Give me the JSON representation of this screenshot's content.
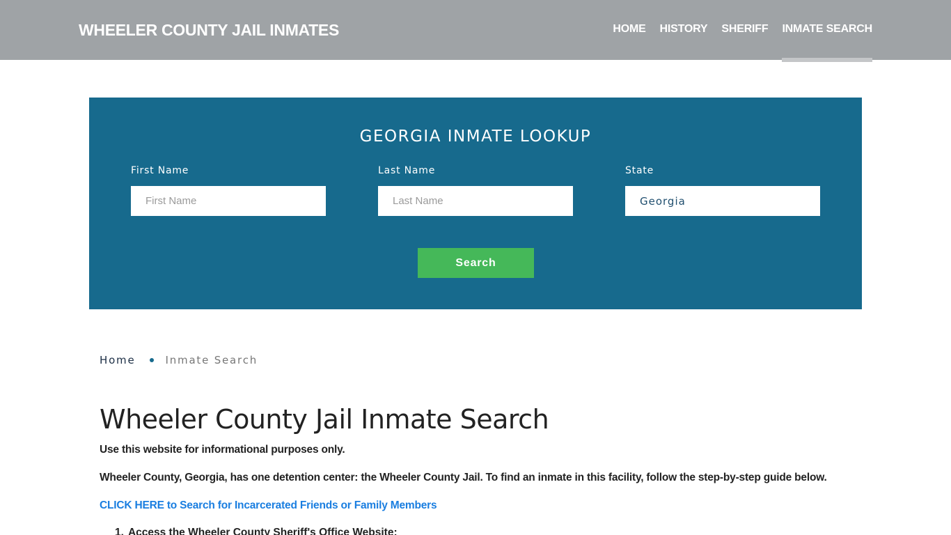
{
  "header": {
    "brand": "WHEELER COUNTY JAIL INMATES",
    "nav": [
      {
        "label": "HOME",
        "active": false
      },
      {
        "label": "HISTORY",
        "active": false
      },
      {
        "label": "SHERIFF",
        "active": false
      },
      {
        "label": "INMATE SEARCH",
        "active": true
      }
    ]
  },
  "lookup": {
    "title": "GEORGIA INMATE LOOKUP",
    "first_name": {
      "label": "First Name",
      "placeholder": "First Name",
      "value": ""
    },
    "last_name": {
      "label": "Last Name",
      "placeholder": "Last Name",
      "value": ""
    },
    "state": {
      "label": "State",
      "selected": "Georgia"
    },
    "search_label": "Search",
    "colors": {
      "panel": "#176a8d",
      "button": "#45b859"
    }
  },
  "breadcrumb": {
    "home": "Home",
    "current": "Inmate Search"
  },
  "content": {
    "title": "Wheeler County Jail Inmate Search",
    "disclaimer": "Use this website for informational purposes only.",
    "intro": "Wheeler County, Georgia, has one detention center: the Wheeler County Jail. To find an inmate in this facility, follow the step-by-step guide below.",
    "cta_link": "CLICK HERE to Search for Incarcerated Friends or Family Members",
    "steps": [
      {
        "num": "1.",
        "text": "Access the Wheeler County Sheriff's Office Website:"
      }
    ]
  }
}
